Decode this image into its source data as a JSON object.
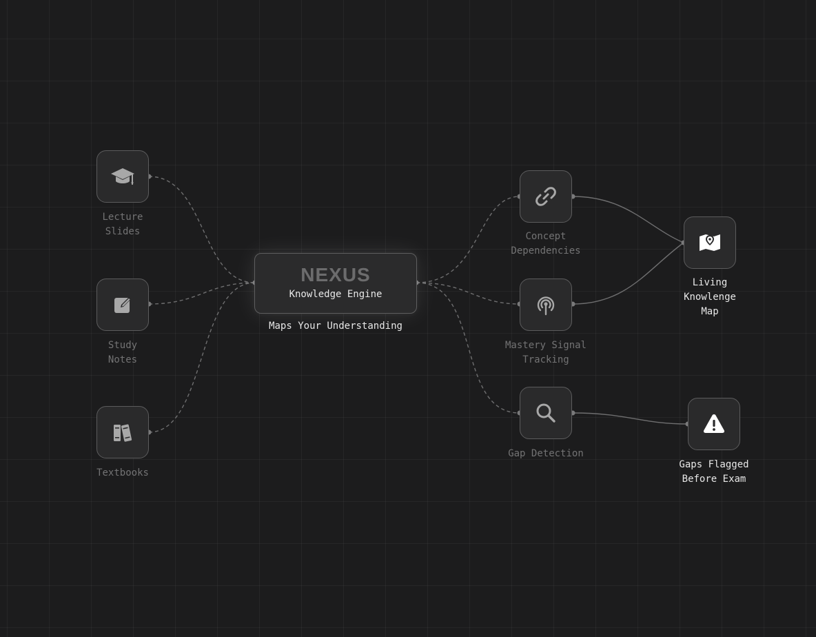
{
  "hub": {
    "title": "NEXUS",
    "subtitle": "Knowledge Engine",
    "caption": "Maps Your Understanding"
  },
  "inputs": [
    {
      "label": "Lecture\nSlides",
      "icon": "graduation-cap-icon"
    },
    {
      "label": "Study\nNotes",
      "icon": "edit-note-icon"
    },
    {
      "label": "Textbooks",
      "icon": "books-icon"
    }
  ],
  "processes": [
    {
      "label": "Concept\nDependencies",
      "icon": "link-icon"
    },
    {
      "label": "Mastery Signal\nTracking",
      "icon": "signal-tracking-icon"
    },
    {
      "label": "Gap Detection",
      "icon": "search-icon"
    }
  ],
  "outputs": [
    {
      "label": "Living\nKnowlenge\nMap",
      "icon": "map-pin-icon"
    },
    {
      "label": "Gaps Flagged\nBefore Exam",
      "icon": "warning-icon"
    }
  ],
  "colors": {
    "background": "#1c1c1d",
    "node_fill": "#2a2a2b",
    "node_border": "#5c5c5d",
    "edge": "#6f6f70",
    "label_dim": "#737374",
    "label_bright": "#e8e8e8",
    "icon": "#a8a8a8",
    "icon_bright": "#ffffff"
  }
}
